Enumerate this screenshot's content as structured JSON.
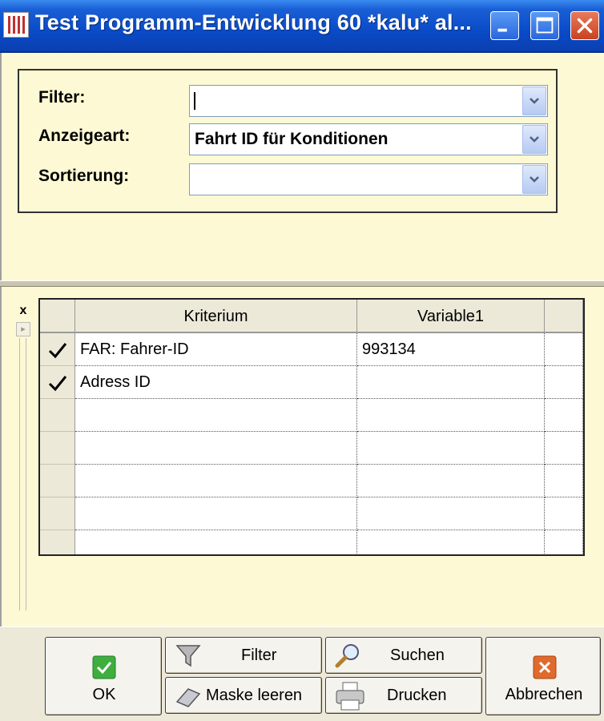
{
  "window": {
    "title": "Test Programm-Entwicklung 60 *kalu*  al...",
    "controls": [
      "minimize",
      "maximize",
      "close"
    ]
  },
  "filter_panel": {
    "filter_label": "Filter:",
    "filter_value": "",
    "display_label": "Anzeigeart:",
    "display_value": "Fahrt ID für Konditionen",
    "sort_label": "Sortierung:",
    "sort_value": ""
  },
  "grid": {
    "columns": [
      "Kriterium",
      "Variable1"
    ],
    "rows": [
      {
        "checked": true,
        "kriterium": "FAR: Fahrer-ID",
        "variable1": "993134"
      },
      {
        "checked": true,
        "kriterium": "Adress ID",
        "variable1": ""
      },
      {
        "checked": false,
        "kriterium": "",
        "variable1": ""
      },
      {
        "checked": false,
        "kriterium": "",
        "variable1": ""
      },
      {
        "checked": false,
        "kriterium": "",
        "variable1": ""
      },
      {
        "checked": false,
        "kriterium": "",
        "variable1": ""
      },
      {
        "checked": false,
        "kriterium": "",
        "variable1": ""
      }
    ],
    "close_glyph": "x"
  },
  "buttons": {
    "ok": "OK",
    "filter": "Filter",
    "search": "Suchen",
    "clear": "Maske leeren",
    "print": "Drucken",
    "cancel": "Abbrechen"
  },
  "colors": {
    "title_bar": "#0a4bc8",
    "panel_background": "#fdf9d4",
    "ok_icon": "#3fae3f",
    "cancel_icon": "#e06a2c"
  },
  "icons": {
    "ok": "check-icon",
    "filter": "funnel-icon",
    "search": "magnifier-icon",
    "clear": "eraser-icon",
    "print": "printer-icon",
    "cancel": "x-icon"
  }
}
